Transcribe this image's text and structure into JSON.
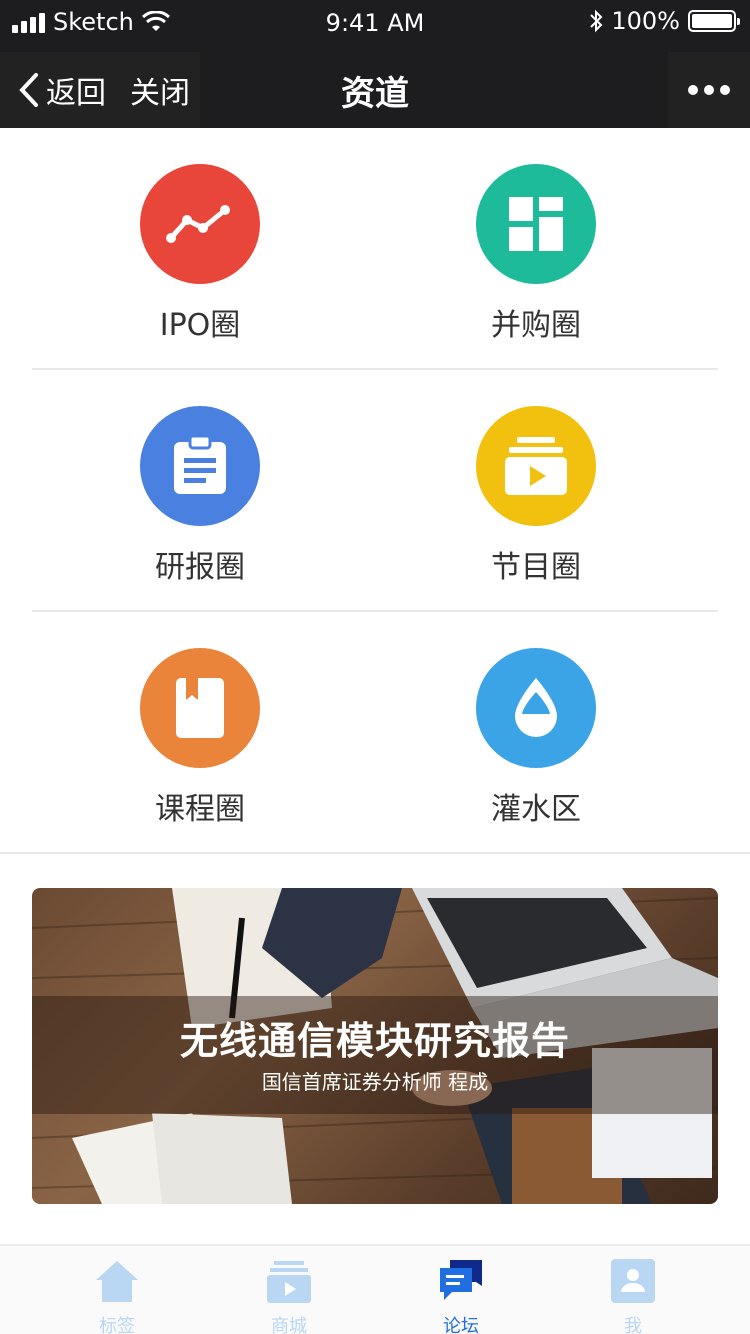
{
  "status_bar": {
    "carrier": "Sketch",
    "time": "9:41 AM",
    "battery": "100%"
  },
  "nav": {
    "back_label": "返回",
    "close_label": "关闭",
    "title": "资道",
    "more_icon": "more-dots-icon"
  },
  "grid": {
    "items": [
      {
        "label": "IPO圈",
        "icon": "trend-line-icon",
        "color": "#e8463b"
      },
      {
        "label": "并购圈",
        "icon": "dashboard-tiles-icon",
        "color": "#1dbb9a"
      },
      {
        "label": "研报圈",
        "icon": "clipboard-icon",
        "color": "#4a80e0"
      },
      {
        "label": "节目圈",
        "icon": "video-play-icon",
        "color": "#f2c10f"
      },
      {
        "label": "课程圈",
        "icon": "book-bookmark-icon",
        "color": "#e9843a"
      },
      {
        "label": "灌水区",
        "icon": "water-drop-icon",
        "color": "#3aa4e6"
      }
    ]
  },
  "banner": {
    "title": "无线通信模块研究报告",
    "subtitle": "国信首席证券分析师 程成"
  },
  "tabbar": {
    "tabs": [
      {
        "label": "标签",
        "icon": "home-icon",
        "active": false
      },
      {
        "label": "商城",
        "icon": "store-video-icon",
        "active": false
      },
      {
        "label": "论坛",
        "icon": "chat-bubbles-icon",
        "active": true
      },
      {
        "label": "我",
        "icon": "profile-icon",
        "active": false
      }
    ]
  },
  "colors": {
    "topbar": "#1d1d1f",
    "active_tab": "#1f6fe0",
    "inactive_tab": "#b9d6f2"
  }
}
